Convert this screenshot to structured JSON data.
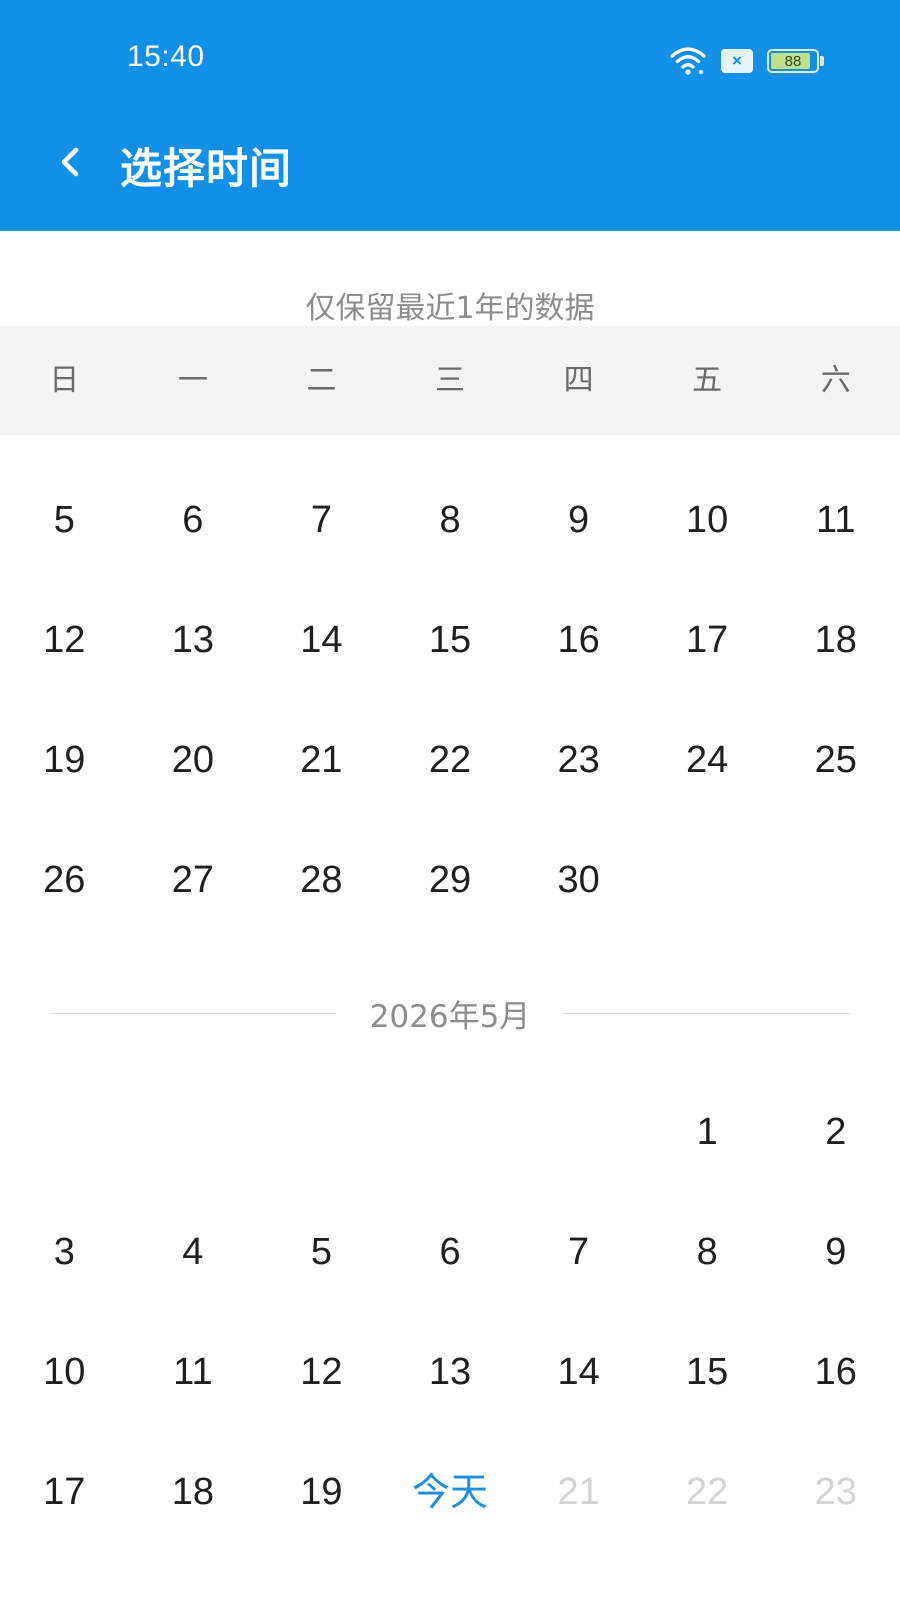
{
  "status_bar": {
    "time": "15:40",
    "x_badge": "×",
    "battery_level": "88",
    "battery_fraction": 0.88
  },
  "header": {
    "title": "选择时间",
    "back_icon": "chevron-left-icon"
  },
  "hint": "仅保留最近1年的数据",
  "weekdays": [
    "日",
    "一",
    "二",
    "三",
    "四",
    "五",
    "六"
  ],
  "april_rows": [
    [
      "5",
      "6",
      "7",
      "8",
      "9",
      "10",
      "11"
    ],
    [
      "12",
      "13",
      "14",
      "15",
      "16",
      "17",
      "18"
    ],
    [
      "19",
      "20",
      "21",
      "22",
      "23",
      "24",
      "25"
    ],
    [
      "26",
      "27",
      "28",
      "29",
      "30",
      "",
      ""
    ]
  ],
  "may": {
    "label": "2026年5月",
    "rows": [
      [
        "",
        "",
        "",
        "",
        "",
        "1",
        "2"
      ],
      [
        "3",
        "4",
        "5",
        "6",
        "7",
        "8",
        "9"
      ],
      [
        "10",
        "11",
        "12",
        "13",
        "14",
        "15",
        "16"
      ],
      [
        "17",
        "18",
        "19",
        "今天",
        "21",
        "22",
        "23"
      ]
    ],
    "today_label": "今天",
    "future_days": [
      "21",
      "22",
      "23"
    ]
  },
  "colors": {
    "header_bg": "#1290e8",
    "today": "#1e8fdc",
    "future": "#d3d3d3"
  }
}
